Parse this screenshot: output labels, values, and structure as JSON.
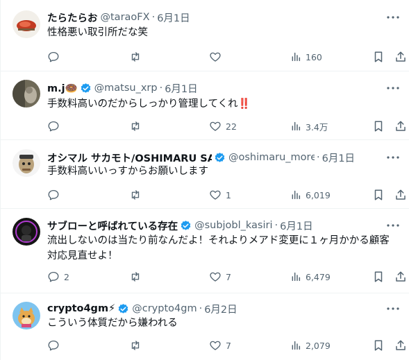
{
  "tweets": [
    {
      "name": "たらたらお",
      "handle": "@taraoFX",
      "date": "6月1日",
      "verified": false,
      "lines": [
        "性格悪い取引所だな笑"
      ],
      "stats": {
        "replies": "",
        "retweets": "",
        "likes": "",
        "views": "160"
      }
    },
    {
      "name": "m.j🍩",
      "handle": "@matsu_xrp",
      "date": "6月1日",
      "verified": true,
      "lines": [
        "手数料高いのだからしっかり管理してくれ‼️"
      ],
      "stats": {
        "replies": "",
        "retweets": "",
        "likes": "22",
        "views": "3.4万"
      }
    },
    {
      "name": "オシマル サカモト/OSHIMARU SAKAMOTO",
      "handle": "@oshimaru_more",
      "date": "6月1日",
      "verified": true,
      "lines": [
        "手数料高いいっすからお願いします"
      ],
      "stats": {
        "replies": "",
        "retweets": "",
        "likes": "1",
        "views": "6,019"
      }
    },
    {
      "name": "サブローと呼ばれている存在",
      "handle": "@subjobl_kasiri",
      "date": "6月1日",
      "verified": true,
      "lines": [
        "流出しないのは当たり前なんだよ！それよりメアド変更に１ヶ月かかる顧客",
        "対応見直せよ！"
      ],
      "stats": {
        "replies": "2",
        "retweets": "",
        "likes": "7",
        "views": "6,479"
      }
    },
    {
      "name": "crypto4gm⚡",
      "handle": "@crypto4gm",
      "date": "6月2日",
      "verified": true,
      "lines": [
        "こういう体質だから嫌われる"
      ],
      "stats": {
        "replies": "",
        "retweets": "",
        "likes": "7",
        "views": "2,079"
      }
    }
  ],
  "colors": {
    "text": "#0f1419",
    "muted": "#536471",
    "verified": "#1d9bf0",
    "divider": "#eff3f4"
  }
}
